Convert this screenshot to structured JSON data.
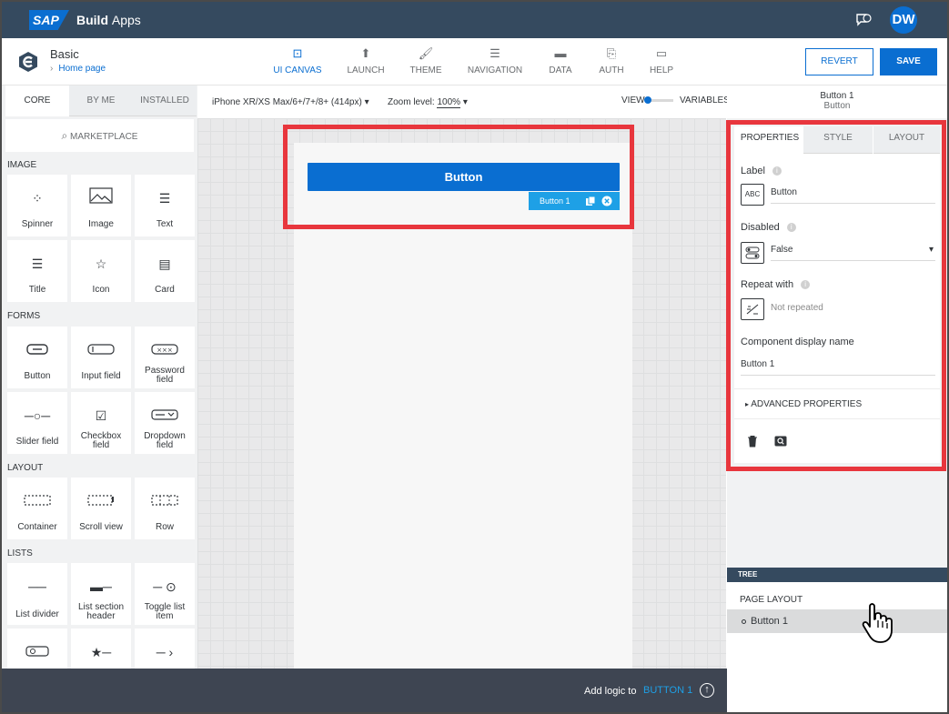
{
  "topbar": {
    "logo_text": "SAP",
    "product_bold": "Build",
    "product_rest": "Apps",
    "avatar_initials": "DW",
    "feedback_icon": "feedback-icon"
  },
  "header": {
    "page_name": "Basic",
    "breadcrumb": "Home page",
    "nav": [
      {
        "label": "UI CANVAS",
        "icon": "canvas-icon"
      },
      {
        "label": "LAUNCH",
        "icon": "launch-icon"
      },
      {
        "label": "THEME",
        "icon": "theme-icon"
      },
      {
        "label": "NAVIGATION",
        "icon": "navigation-icon"
      },
      {
        "label": "DATA",
        "icon": "data-icon"
      },
      {
        "label": "AUTH",
        "icon": "auth-icon"
      },
      {
        "label": "HELP",
        "icon": "help-icon"
      }
    ],
    "revert_label": "REVERT",
    "save_label": "SAVE"
  },
  "palette": {
    "tabs": [
      "CORE",
      "BY ME",
      "INSTALLED"
    ],
    "marketplace": "MARKETPLACE",
    "sections": {
      "image": "IMAGE",
      "forms": "FORMS",
      "layout": "LAYOUT",
      "lists": "LISTS"
    },
    "tiles": {
      "spinner": "Spinner",
      "image": "Image",
      "text": "Text",
      "title": "Title",
      "icon": "Icon",
      "card": "Card",
      "button": "Button",
      "input": "Input field",
      "password": "Password field",
      "slider": "Slider field",
      "checkbox": "Checkbox field",
      "dropdown": "Dropdown field",
      "container": "Container",
      "scroll": "Scroll view",
      "row": "Row",
      "divider": "List divider",
      "section_header": "List section header",
      "toggle_item": "Toggle list item"
    }
  },
  "canvas_toolbar": {
    "device": "iPhone XR/XS Max/6+/7+/8+ (414px)",
    "zoom_label": "Zoom level:",
    "zoom_value": "100%",
    "view_label": "VIEW",
    "variables_label": "VARIABLES"
  },
  "canvas": {
    "button_label": "Button",
    "selection_tag": "Button 1"
  },
  "bottombar": {
    "add_logic": "Add logic to",
    "target": "BUTTON 1"
  },
  "right": {
    "selected_name": "Button 1",
    "selected_type": "Button",
    "tabs": [
      "PROPERTIES",
      "STYLE",
      "LAYOUT"
    ],
    "label_title": "Label",
    "label_value": "Button",
    "label_box": "ABC",
    "disabled_title": "Disabled",
    "disabled_value": "False",
    "repeat_title": "Repeat with",
    "repeat_value": "Not repeated",
    "name_title": "Component display name",
    "name_value": "Button 1",
    "advanced": "ADVANCED PROPERTIES"
  },
  "tree": {
    "header": "TREE",
    "title": "PAGE LAYOUT",
    "item": "Button 1"
  },
  "colors": {
    "accent": "#0a6ed1",
    "shell": "#354a5f",
    "highlight": "#e8363d",
    "tag": "#1ea0e6"
  }
}
